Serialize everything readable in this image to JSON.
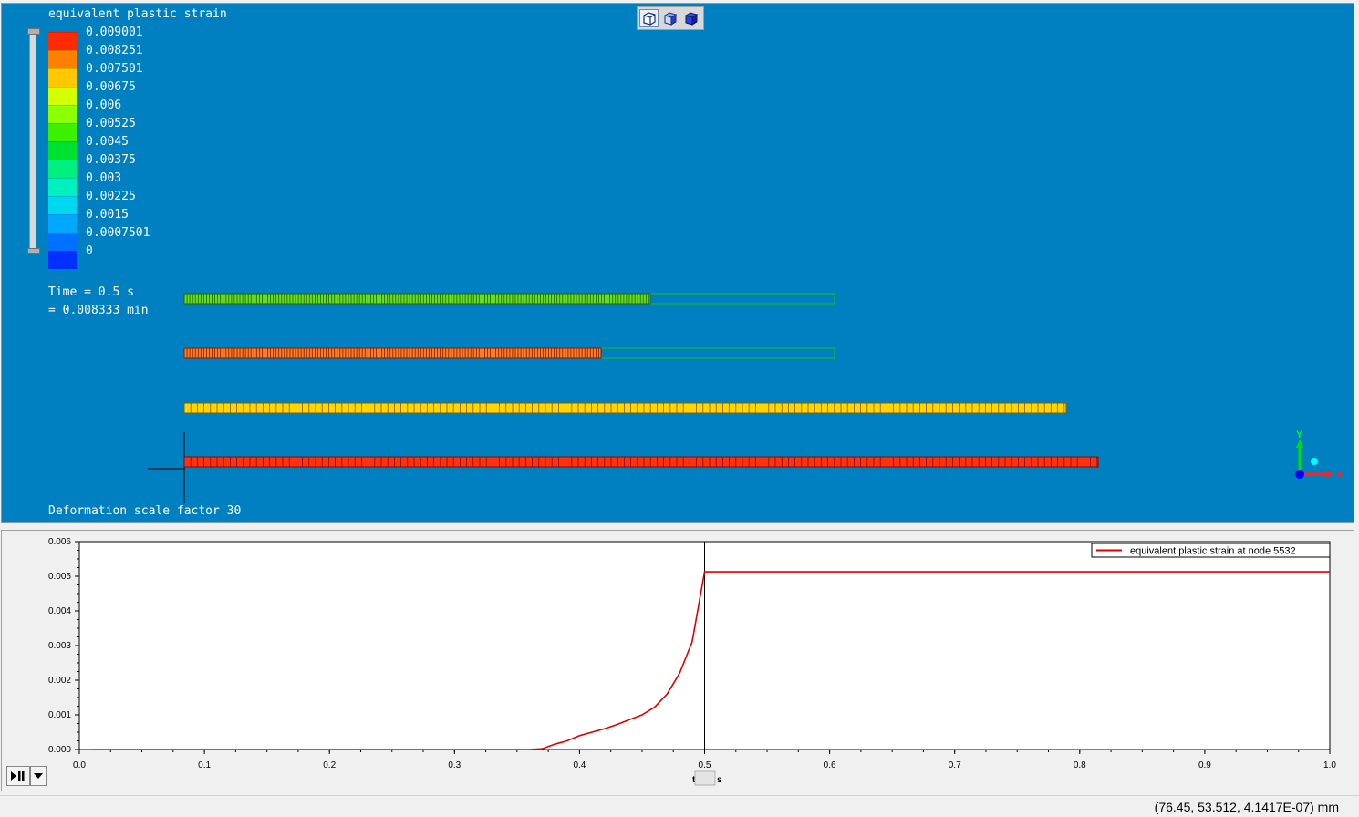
{
  "viewport": {
    "legend_title": "equivalent plastic strain",
    "legend": [
      {
        "label": "0.009001",
        "color": "#ff2a00"
      },
      {
        "label": "0.008251",
        "color": "#ff7f00"
      },
      {
        "label": "0.007501",
        "color": "#ffc800"
      },
      {
        "label": "0.00675",
        "color": "#d4ff00"
      },
      {
        "label": "0.006",
        "color": "#8cff00"
      },
      {
        "label": "0.00525",
        "color": "#3cf000"
      },
      {
        "label": "0.0045",
        "color": "#00e030"
      },
      {
        "label": "0.00375",
        "color": "#00f080"
      },
      {
        "label": "0.003",
        "color": "#00f0c0"
      },
      {
        "label": "0.00225",
        "color": "#00d8f0"
      },
      {
        "label": "0.0015",
        "color": "#00a8ff"
      },
      {
        "label": "0.0007501",
        "color": "#0070ff"
      },
      {
        "label": "0",
        "color": "#0030ff"
      }
    ],
    "time_line1": "Time = 0.5 s",
    "time_line2": "= 0.008333 min",
    "deformation_text": "Deformation scale factor 30",
    "background_color": "#0080c0",
    "bars": [
      {
        "color": "#66dd22",
        "stroke": "#226600"
      },
      {
        "color": "#ff7a22",
        "stroke": "#802000"
      },
      {
        "color": "#ffd400",
        "stroke": "#806000"
      },
      {
        "color": "#ff3010",
        "stroke": "#801000"
      }
    ],
    "axis_triad": {
      "y_label": "Y",
      "x_label": "X"
    },
    "toolbar_icons": [
      "wireframe-cube-icon",
      "shaded-cube-icon",
      "solid-cube-icon"
    ]
  },
  "chart_data": {
    "type": "line",
    "series": [
      {
        "name": "equivalent plastic strain at node 5532",
        "color": "#e00000",
        "x": [
          0.01,
          0.3,
          0.36,
          0.37,
          0.38,
          0.39,
          0.4,
          0.41,
          0.42,
          0.43,
          0.44,
          0.45,
          0.46,
          0.47,
          0.48,
          0.49,
          0.5,
          1.0
        ],
        "y": [
          0.0,
          0.0,
          0.0,
          2e-05,
          0.00015,
          0.00025,
          0.0004,
          0.0005,
          0.0006,
          0.00072,
          0.00086,
          0.001,
          0.00122,
          0.0016,
          0.0022,
          0.0031,
          0.00513,
          0.00513
        ]
      }
    ],
    "xlim": [
      0.0,
      1.0
    ],
    "ylim": [
      0.0,
      0.006
    ],
    "xticks": [
      "0.0",
      "0.1",
      "0.2",
      "0.3",
      "0.4",
      "0.5",
      "0.6",
      "0.7",
      "0.8",
      "0.9",
      "1.0"
    ],
    "yticks": [
      "0.000",
      "0.001",
      "0.002",
      "0.003",
      "0.004",
      "0.005",
      "0.006"
    ],
    "xlabel_prefix": "t",
    "xlabel_unit": "s",
    "cursor_x": 0.5,
    "grid": false,
    "legend_position": "top-right"
  },
  "status": {
    "coordinates": "(76.45, 53.512, 4.1417E-07) mm"
  }
}
